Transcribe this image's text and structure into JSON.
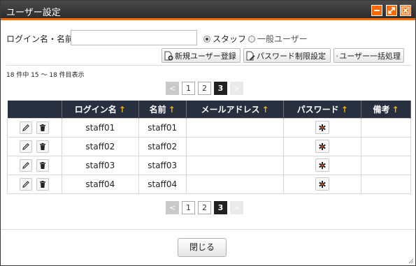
{
  "window": {
    "title": "ユーザー設定",
    "accent": "#ff6a00"
  },
  "titlebar_buttons": [
    "minimize-icon",
    "maximize-icon",
    "close-icon"
  ],
  "search": {
    "label": "ログイン名・名前",
    "value": "",
    "placeholder": ""
  },
  "filter": {
    "options": [
      {
        "label": "スタッフ",
        "selected": true
      },
      {
        "label": "一般ユーザー",
        "selected": false
      }
    ]
  },
  "actions": {
    "new_user": "新規ユーザー登録",
    "password_rule": "パスワード制限設定",
    "batch": "ユーザー一括処理"
  },
  "result_count": "18 件中 15 ～ 18 件目表示",
  "pager": {
    "prev": "<",
    "pages": [
      "1",
      "2",
      "3"
    ],
    "current": "3",
    "next": ">"
  },
  "table": {
    "headers": [
      "",
      "ログイン名",
      "名前",
      "メールアドレス",
      "パスワード",
      "備考"
    ],
    "sort_arrow": "↑",
    "rows": [
      {
        "login": "staff01",
        "name": "staff01",
        "email": "",
        "note": ""
      },
      {
        "login": "staff02",
        "name": "staff02",
        "email": "",
        "note": ""
      },
      {
        "login": "staff03",
        "name": "staff03",
        "email": "",
        "note": ""
      },
      {
        "login": "staff04",
        "name": "staff04",
        "email": "",
        "note": ""
      }
    ]
  },
  "footer": {
    "close_label": "閉じる"
  }
}
